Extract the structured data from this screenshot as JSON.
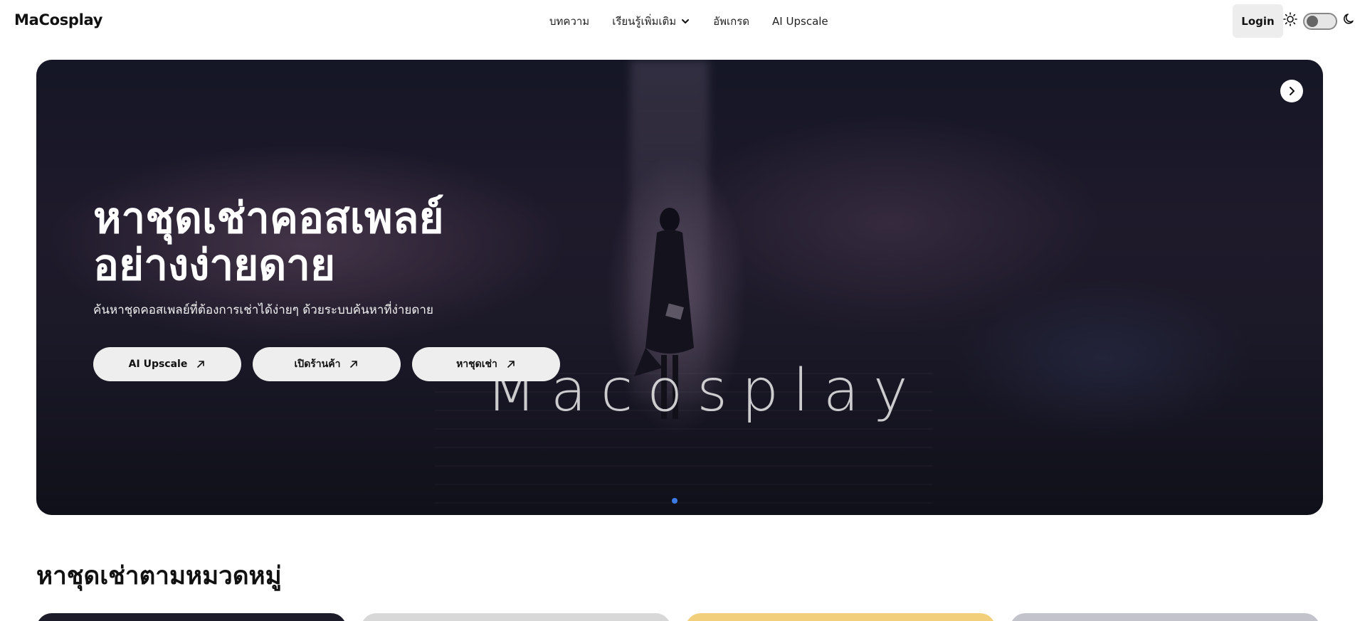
{
  "header": {
    "brand": "MaCosplay",
    "nav": [
      {
        "label": "บทความ"
      },
      {
        "label": "เรียนรู้เพิ่มเติม",
        "has_dropdown": true
      },
      {
        "label": "อัพเกรด"
      },
      {
        "label": "AI Upscale"
      }
    ],
    "login_label": "Login",
    "theme_toggle": {
      "sun_icon": "sun-icon",
      "moon_icon": "moon-icon",
      "dark_mode": false
    }
  },
  "hero": {
    "title_line1": "หาชุดเช่าคอสเพลย์",
    "title_line2": "อย่างง่ายดาย",
    "subtitle": "ค้นหาชุดคอสเพลย์ที่ต้องการเช่าได้ง่ายๆ ด้วยระบบค้นหาที่ง่ายดาย",
    "buttons": [
      {
        "label": "AI Upscale",
        "icon": "arrow-up-right-icon"
      },
      {
        "label": "เปิดร้านค้า",
        "icon": "arrow-up-right-icon"
      },
      {
        "label": "หาชุดเช่า",
        "icon": "arrow-up-right-icon"
      }
    ],
    "watermark": "Macosplay",
    "next_icon": "chevron-right-icon",
    "active_dot_color": "#3b7be8"
  },
  "categories_section": {
    "title": "หาชุดเช่าตามหมวดหมู่",
    "card_colors": [
      "#1c1c2a",
      "#d8d8d8",
      "#f2cf7a",
      "#c3c3cc"
    ]
  }
}
